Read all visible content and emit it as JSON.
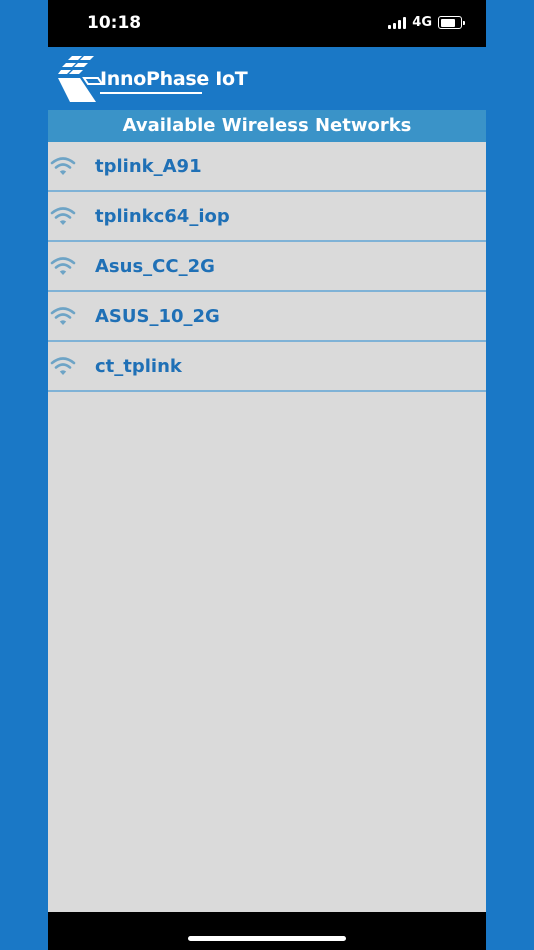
{
  "status_bar": {
    "time": "10:18",
    "network_type": "4G",
    "battery_level": 0.75,
    "icons": [
      "signal-icon",
      "battery-icon"
    ]
  },
  "header": {
    "logo_text": "InnoPhase IoT",
    "logo_icon": "innophase-logo-icon"
  },
  "list": {
    "title": "Available Wireless Networks",
    "networks": [
      {
        "ssid": "tplink_A91",
        "icon": "wifi-icon"
      },
      {
        "ssid": "tplinkc64_iop",
        "icon": "wifi-icon"
      },
      {
        "ssid": "Asus_CC_2G",
        "icon": "wifi-icon"
      },
      {
        "ssid": "ASUS_10_2G",
        "icon": "wifi-icon"
      },
      {
        "ssid": "ct_tplink",
        "icon": "wifi-icon"
      }
    ]
  },
  "colors": {
    "brand_blue": "#1a78c6",
    "header_bar": "#3a93c8",
    "network_text": "#1f70b6",
    "list_background": "#dadada"
  }
}
